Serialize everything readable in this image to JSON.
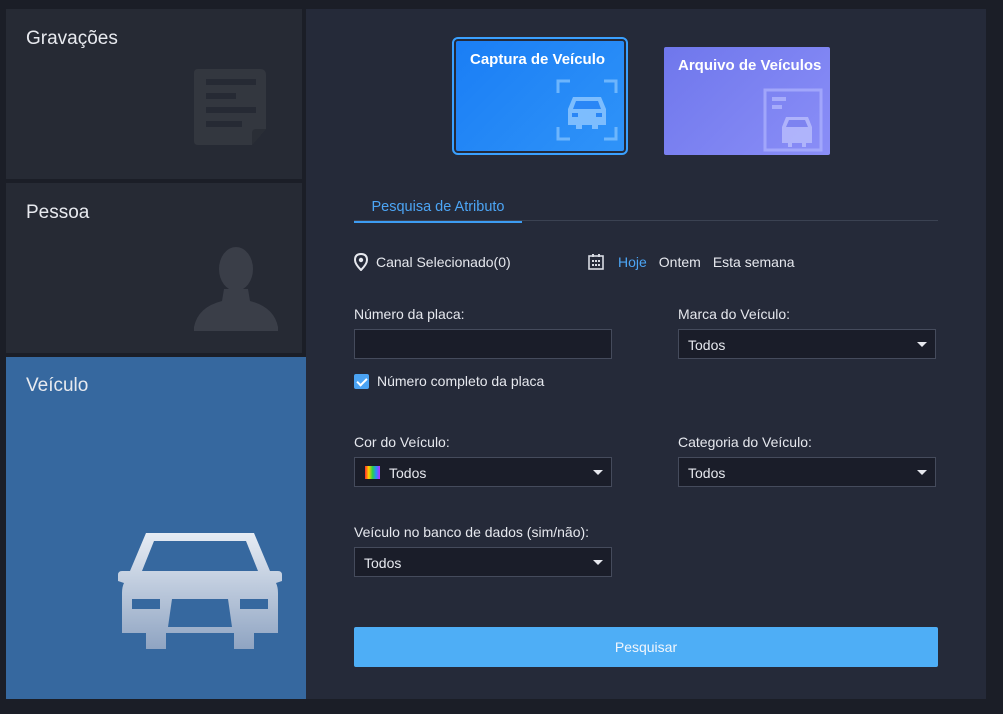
{
  "sidebar": {
    "items": [
      {
        "label": "Gravações",
        "icon": "document-icon"
      },
      {
        "label": "Pessoa",
        "icon": "person-icon"
      },
      {
        "label": "Veículo",
        "icon": "car-icon"
      }
    ]
  },
  "modes": {
    "capture_label": "Captura de Veículo",
    "archive_label": "Arquivo de Veículos"
  },
  "tabs": [
    {
      "label": "Pesquisa de Atributo"
    }
  ],
  "channel": {
    "label": "Canal Selecionado(0)"
  },
  "date_filter": {
    "options": [
      "Hoje",
      "Ontem",
      "Esta semana"
    ],
    "selected": "Hoje"
  },
  "form": {
    "plate_label": "Número da placa:",
    "plate_value": "",
    "full_plate_label": "Número completo da placa",
    "full_plate_checked": true,
    "brand_label": "Marca do Veículo:",
    "brand_value": "Todos",
    "color_label": "Cor do Veículo:",
    "color_value": "Todos",
    "category_label": "Categoria do Veículo:",
    "category_value": "Todos",
    "db_label": "Veículo no banco de dados (sim/não):",
    "db_value": "Todos"
  },
  "search_button": "Pesquisar",
  "colors": {
    "accent": "#4ca5f5",
    "active_nav": "#36689f",
    "capture_btn": "#1a7ef5",
    "archive_btn": "#7c82f2"
  }
}
